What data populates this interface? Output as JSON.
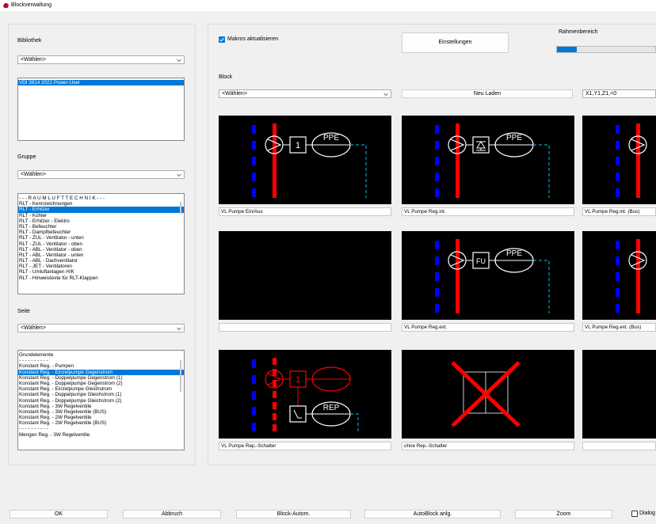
{
  "window": {
    "title": "Blockverwaltung"
  },
  "left": {
    "bibliothek": {
      "label": "Bibliothek",
      "combo_value": "<Wählen>",
      "items": [
        {
          "text": "VDI 3814 2022 Power-User",
          "selected": true
        }
      ]
    },
    "gruppe": {
      "label": "Gruppe",
      "combo_value": "<Wählen>",
      "items": [
        {
          "text": "- - - R A U M L U F T T E C H N I K - - -",
          "selected": false
        },
        {
          "text": "RLT - Kennzeichnungen",
          "selected": false
        },
        {
          "text": "RLT - Erhitzer",
          "selected": true
        },
        {
          "text": "RLT - Kühler",
          "selected": false
        },
        {
          "text": "RLT - Erhitzer - Elektro",
          "selected": false
        },
        {
          "text": "RLT - Befeuchter",
          "selected": false
        },
        {
          "text": "RLT - Dampfbefeuchter",
          "selected": false
        },
        {
          "text": "RLT - ZUL - Ventilator - unten",
          "selected": false
        },
        {
          "text": "RLT - ZUL - Ventilator - oben",
          "selected": false
        },
        {
          "text": "RLT - ABL - Ventilator - oben",
          "selected": false
        },
        {
          "text": "RLT - ABL - Ventilator - unten",
          "selected": false
        },
        {
          "text": "RLT - ABL - Dachventilator",
          "selected": false
        },
        {
          "text": "RLT - JET - Ventilatoren",
          "selected": false
        },
        {
          "text": "RLT - Umluftanlagen H/K",
          "selected": false
        },
        {
          "text": "RLT - Hinweistexte für RLT-Klappen",
          "selected": false
        }
      ]
    },
    "seite": {
      "label": "Seite",
      "combo_value": "<Wählen>",
      "items": [
        {
          "text": "Grundelemente",
          "selected": false
        },
        {
          "text": "- - - - - - - - - -",
          "selected": false
        },
        {
          "text": "Konstant Reg. - Pumpen",
          "selected": false
        },
        {
          "text": "Konstant Reg. - Einzelpumpe Gegenstrom",
          "selected": true
        },
        {
          "text": "Konstant Reg. - Doppelpumpe Gegenstrom (1)",
          "selected": false
        },
        {
          "text": "Konstant Reg. - Doppelpumpe Gegenstrom (2)",
          "selected": false
        },
        {
          "text": "Konstant Reg. - Einzelpumpe Gleichstrom",
          "selected": false
        },
        {
          "text": "Konstant Reg. - Doppelpumpe Gleichstrom (1)",
          "selected": false
        },
        {
          "text": "Konstant Reg. - Doppelpumpe Gleichstrom (2)",
          "selected": false
        },
        {
          "text": "Konstant Reg. - 3W Regelventile",
          "selected": false
        },
        {
          "text": "Konstant Reg. - 3W Regelventile (BUS)",
          "selected": false
        },
        {
          "text": "Konstant Reg. - 2W Regelventile",
          "selected": false
        },
        {
          "text": "Konstant Reg. - 2W Regelventile (BUS)",
          "selected": false
        },
        {
          "text": "- - - - - - - - - -",
          "selected": false
        },
        {
          "text": "Mengen Reg. - 3W Regelventile",
          "selected": false
        }
      ]
    }
  },
  "right": {
    "makros_checkbox": {
      "label": "Makros aktualisieren",
      "checked": true
    },
    "einstellungen_button": "Einstellungen",
    "rahmenbereich": {
      "label": "Rahmenbereich",
      "progress_fraction": 0.2
    },
    "block": {
      "label": "Block",
      "combo_value": "<Wählen>",
      "neu_laden_button": "Neu Laden",
      "coords_value": "X1,Y1,Z1,<0"
    },
    "previews": [
      {
        "caption": "VL Pumpe Ein/Aus",
        "box_text": "1",
        "ellipse_text": "PPE",
        "kind": "pump-box"
      },
      {
        "caption": "VL Pumpe Reg.int.",
        "box_text": "",
        "ellipse_text": "PPE",
        "kind": "pump-diode"
      },
      {
        "caption": "VL Pumpe Reg.int. (Bus)",
        "box_text": "",
        "ellipse_text": "",
        "kind": "pump-partial"
      },
      {
        "caption": "",
        "box_text": "",
        "ellipse_text": "",
        "kind": "empty"
      },
      {
        "caption": "VL Pumpe Reg.ext.",
        "box_text": "FU",
        "ellipse_text": "PPE",
        "kind": "pump-box"
      },
      {
        "caption": "VL Pumpe Reg.ext. (Bus)",
        "box_text": "",
        "ellipse_text": "",
        "kind": "pump-partial"
      },
      {
        "caption": "VL Pumpe Rep.-Schalter",
        "box_text": "1",
        "ellipse_text": "REP",
        "kind": "pump-rep"
      },
      {
        "caption": "ohne Rep.-Schalter",
        "box_text": "",
        "ellipse_text": "",
        "kind": "cross"
      },
      {
        "caption": "",
        "box_text": "",
        "ellipse_text": "",
        "kind": "empty-partial"
      }
    ]
  },
  "bottom": {
    "ok": "OK",
    "abbruch": "Abbruch",
    "block_autom": "Block-Autom.",
    "autoblock": "AutoBlock anlg.",
    "zoom": "Zoom",
    "dialog_checkbox": {
      "label": "Dialog",
      "checked": false
    }
  },
  "colors": {
    "selection": "#0078d7",
    "pipe_red": "#ff0000",
    "pipe_blue": "#0000ff",
    "dashed_cyan": "#00a0c8",
    "progress": "#0078d7"
  }
}
